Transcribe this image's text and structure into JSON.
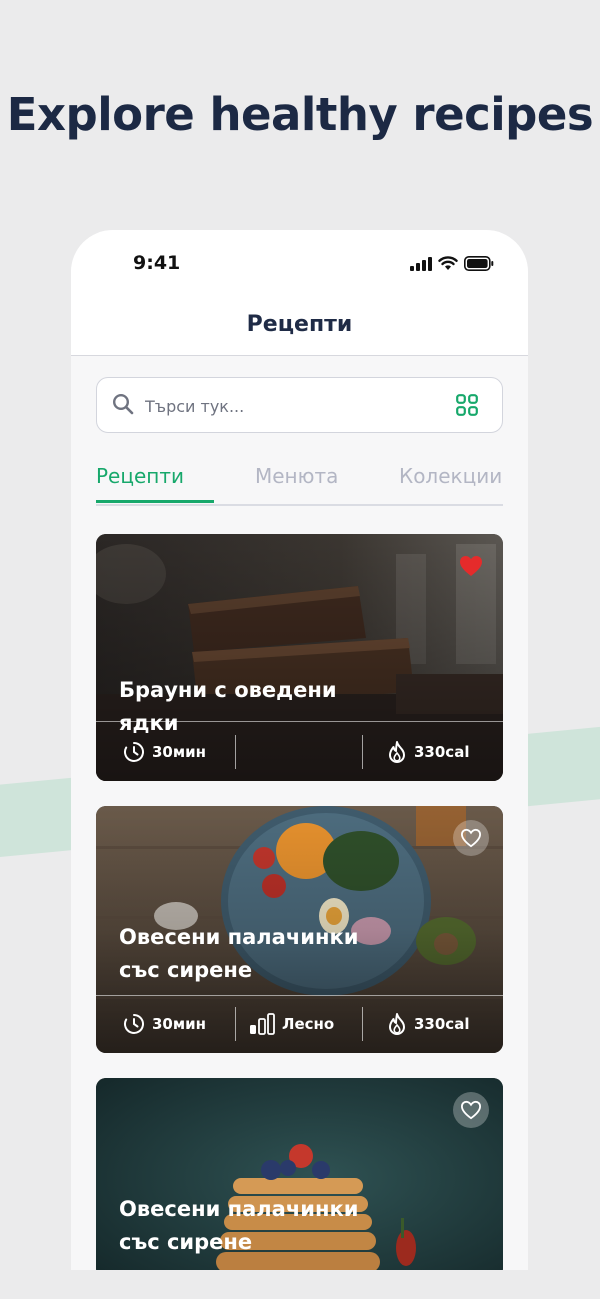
{
  "headline": "Explore healthy recipes",
  "status_bar": {
    "time": "9:41"
  },
  "screen": {
    "title": "Рецепти"
  },
  "search": {
    "placeholder": "Търси тук..."
  },
  "tabs": [
    {
      "label": "Рецепти",
      "active": true
    },
    {
      "label": "Менюта",
      "active": false
    },
    {
      "label": "Колекции",
      "active": false
    }
  ],
  "recipes": [
    {
      "title_lines": [
        "Брауни с оведени ядки"
      ],
      "time": "30мин",
      "difficulty": "",
      "calories": "330cal",
      "favorite": true
    },
    {
      "title_lines": [
        "Овесени палачинки",
        "със сирене"
      ],
      "time": "30мин",
      "difficulty": "Лесно",
      "calories": "330cal",
      "favorite": false
    },
    {
      "title_lines": [
        "Овесени палачинки",
        "със сирене"
      ],
      "time": "",
      "difficulty": "",
      "calories": "",
      "favorite": false
    }
  ],
  "colors": {
    "accent": "#17a86b",
    "headline": "#1c2944",
    "favorite_active": "#e52b2b"
  },
  "icons": [
    "search-icon",
    "grid-icon",
    "clock-icon",
    "difficulty-bars-icon",
    "flame-icon",
    "heart-icon",
    "signal-icon",
    "wifi-icon",
    "battery-icon"
  ]
}
